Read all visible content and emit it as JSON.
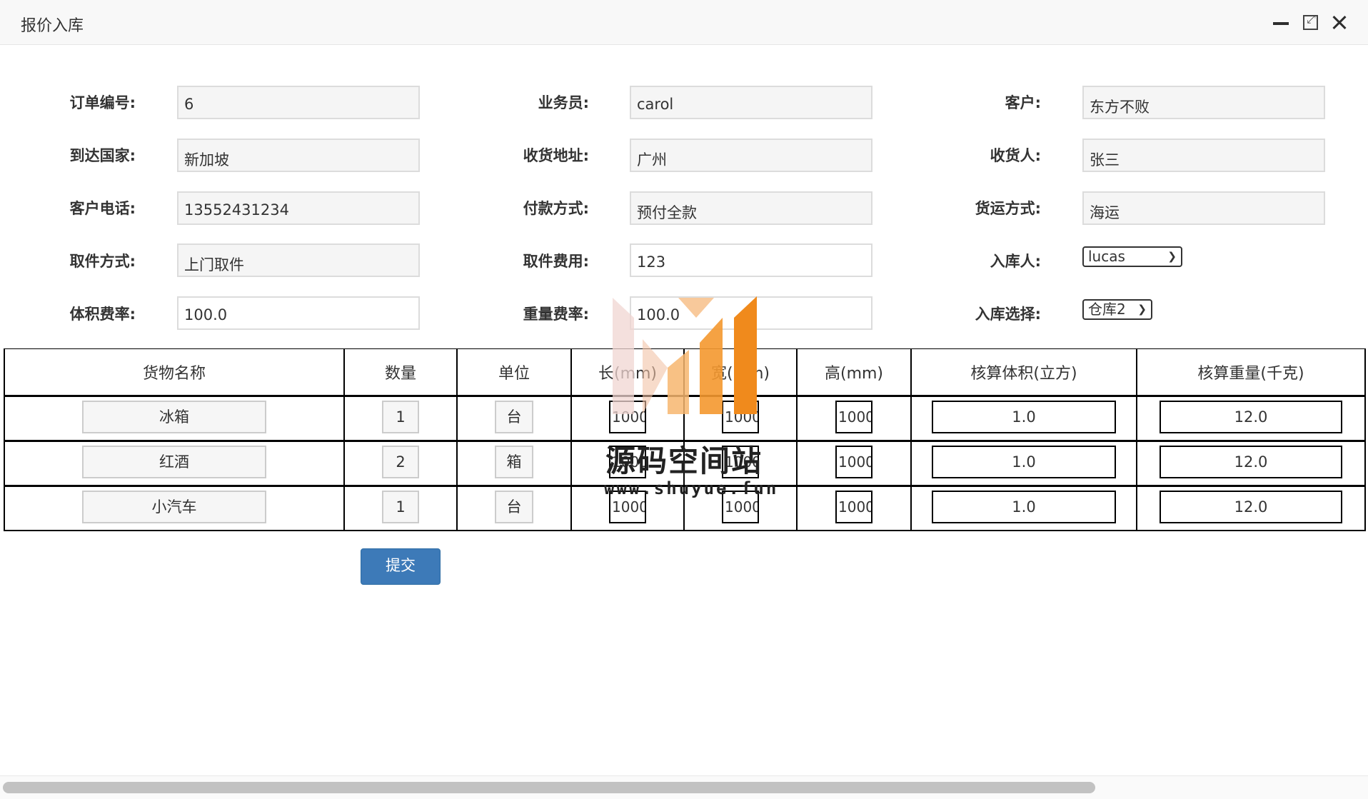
{
  "window": {
    "title": "报价入库"
  },
  "form": {
    "order_no_label": "订单编号:",
    "order_no": "6",
    "salesman_label": "业务员:",
    "salesman": "carol",
    "customer_label": "客户:",
    "customer": "东方不败",
    "country_label": "到达国家:",
    "country": "新加坡",
    "address_label": "收货地址:",
    "address": "广州",
    "consignee_label": "收货人:",
    "consignee": "张三",
    "phone_label": "客户电话:",
    "phone": "13552431234",
    "payment_label": "付款方式:",
    "payment": "预付全款",
    "shipping_label": "货运方式:",
    "shipping": "海运",
    "pickup_label": "取件方式:",
    "pickup": "上门取件",
    "pickup_fee_label": "取件费用:",
    "pickup_fee": "123",
    "storer_label": "入库人:",
    "storer": "lucas",
    "volume_rate_label": "体积费率:",
    "volume_rate": "100.0",
    "weight_rate_label": "重量费率:",
    "weight_rate": "100.0",
    "warehouse_label": "入库选择:",
    "warehouse": "仓库2"
  },
  "table": {
    "headers": [
      "货物名称",
      "数量",
      "单位",
      "长(mm)",
      "宽(mm)",
      "高(mm)",
      "核算体积(立方)",
      "核算重量(千克)"
    ],
    "rows": [
      {
        "name": "冰箱",
        "qty": "1",
        "unit": "台",
        "length": "1000",
        "width": "1000",
        "height": "1000",
        "volume": "1.0",
        "weight": "12.0"
      },
      {
        "name": "红酒",
        "qty": "2",
        "unit": "箱",
        "length": "1000",
        "width": "1000",
        "height": "1000",
        "volume": "1.0",
        "weight": "12.0"
      },
      {
        "name": "小汽车",
        "qty": "1",
        "unit": "台",
        "length": "1000",
        "width": "1000",
        "height": "1000",
        "volume": "1.0",
        "weight": "12.0"
      }
    ]
  },
  "actions": {
    "submit_label": "提交"
  },
  "watermark": {
    "text": "源码空间站",
    "url": "www.shuyue.fun"
  },
  "colors": {
    "submit_button": "#3d7ab8",
    "watermark_orange": "#f08a1c"
  }
}
